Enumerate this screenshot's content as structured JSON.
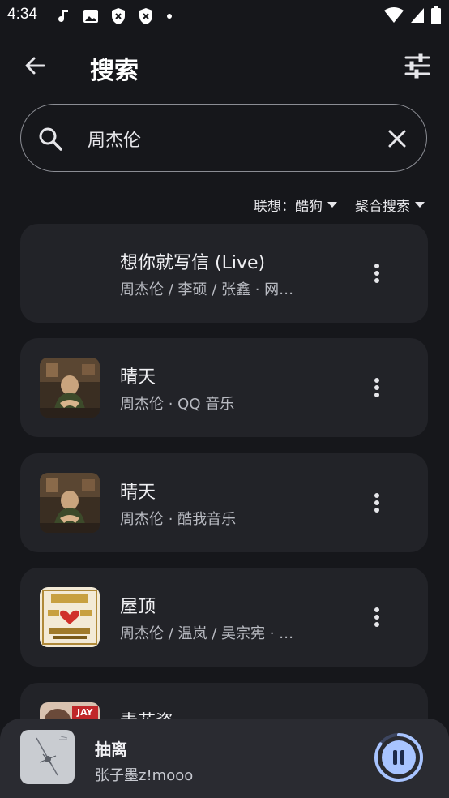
{
  "status": {
    "time": "4:34"
  },
  "header": {
    "title": "搜索"
  },
  "search": {
    "value": "周杰伦",
    "placeholder": ""
  },
  "filters": {
    "suggest_label": "联想：酷狗",
    "mode_label": "聚合搜索"
  },
  "results": [
    {
      "title": "想你就写信 (Live)",
      "subtitle": "周杰伦 / 李硕 / 张鑫 · 网…"
    },
    {
      "title": "晴天",
      "subtitle": "周杰伦 · QQ 音乐"
    },
    {
      "title": "晴天",
      "subtitle": "周杰伦 · 酷我音乐"
    },
    {
      "title": "屋顶",
      "subtitle": "周杰伦 / 温岚 / 吴宗宪 · …"
    },
    {
      "title": "青花瓷",
      "subtitle": ""
    }
  ],
  "player": {
    "title": "抽离",
    "artist": "张子墨z!mooo",
    "progress": 0.85
  },
  "colors": {
    "accent": "#a8c4ff",
    "card": "#222328",
    "background": "#16171b"
  }
}
